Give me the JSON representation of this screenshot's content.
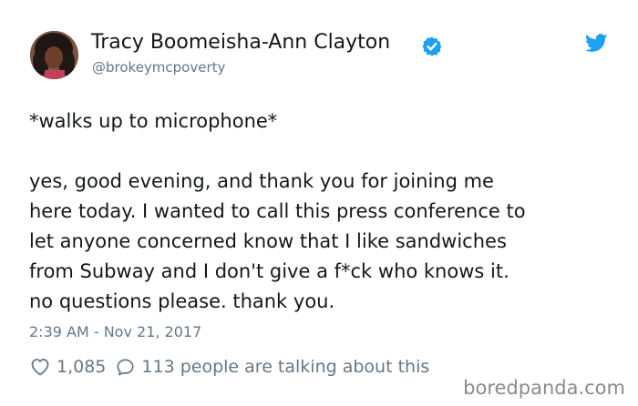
{
  "author": {
    "display_name": "Tracy Boomeisha-Ann Clayton",
    "handle": "@brokeymcpoverty",
    "verified": true
  },
  "icons": {
    "verified": "verified-badge-icon",
    "platform": "twitter-bird-icon",
    "like": "heart-icon",
    "reply": "speech-bubble-icon"
  },
  "tweet": {
    "paragraphs": [
      [
        "*walks up to microphone*"
      ],
      [
        "yes, good evening, and thank you for joining me",
        "here today. I wanted to call this press conference to",
        "let anyone concerned know that I like sandwiches",
        "from Subway and I don't give a f*ck who knows it.",
        "no questions please. thank you."
      ]
    ],
    "timestamp": "2:39 AM - Nov 21, 2017"
  },
  "stats": {
    "likes": "1,085",
    "talking": "113 people are talking about this"
  },
  "watermark": "boredpanda.com",
  "colors": {
    "text": "#14171a",
    "secondary": "#657786",
    "twitter_blue": "#1da1f2",
    "watermark": "#8a8a8a"
  }
}
